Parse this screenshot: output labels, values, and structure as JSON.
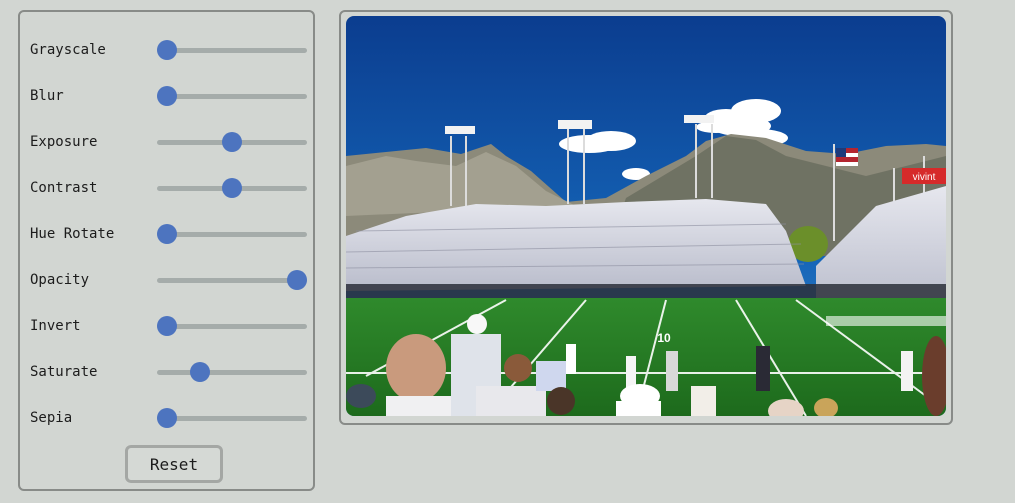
{
  "controls": [
    {
      "label": "Grayscale",
      "value": 0,
      "min": 0,
      "max": 1
    },
    {
      "label": "Blur",
      "value": 0,
      "min": 0,
      "max": 20
    },
    {
      "label": "Exposure",
      "value": 1,
      "min": 0,
      "max": 2
    },
    {
      "label": "Contrast",
      "value": 1,
      "min": 0,
      "max": 2
    },
    {
      "label": "Hue Rotate",
      "value": 0,
      "min": 0,
      "max": 360
    },
    {
      "label": "Opacity",
      "value": 1,
      "min": 0,
      "max": 1
    },
    {
      "label": "Invert",
      "value": 0,
      "min": 0,
      "max": 1
    },
    {
      "label": "Saturate",
      "value": 1,
      "min": 0,
      "max": 4
    },
    {
      "label": "Sepia",
      "value": 0,
      "min": 0,
      "max": 1
    }
  ],
  "reset_label": "Reset",
  "photo": {
    "scoreboard_text": "vivint",
    "yard_marker": "10"
  },
  "colors": {
    "background": "#d2d6d2",
    "thumb": "#4d74bf",
    "track": "#a5acaa",
    "border": "#888b88"
  }
}
